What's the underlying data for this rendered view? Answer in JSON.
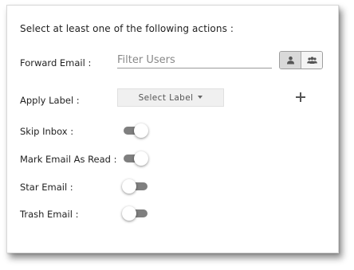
{
  "heading": "Select at least one of the following actions :",
  "forward_email": {
    "label": "Forward Email :",
    "filter_placeholder": "Filter Users",
    "filter_value": "",
    "user_icon": "user-icon",
    "group_icon": "group-icon",
    "selected": "user"
  },
  "apply_label": {
    "label": "Apply Label :",
    "select_text": "Select Label",
    "add_icon": "plus-icon"
  },
  "options": [
    {
      "label": "Skip Inbox :",
      "enabled": true
    },
    {
      "label": "Mark Email As Read :",
      "enabled": true
    },
    {
      "label": "Star Email :",
      "enabled": false
    },
    {
      "label": "Trash Email :",
      "enabled": false
    }
  ],
  "colors": {
    "toggle_track": "#7f7f7f",
    "segment_active": "#d9d9d9",
    "select_bg": "#f0f0f0"
  }
}
